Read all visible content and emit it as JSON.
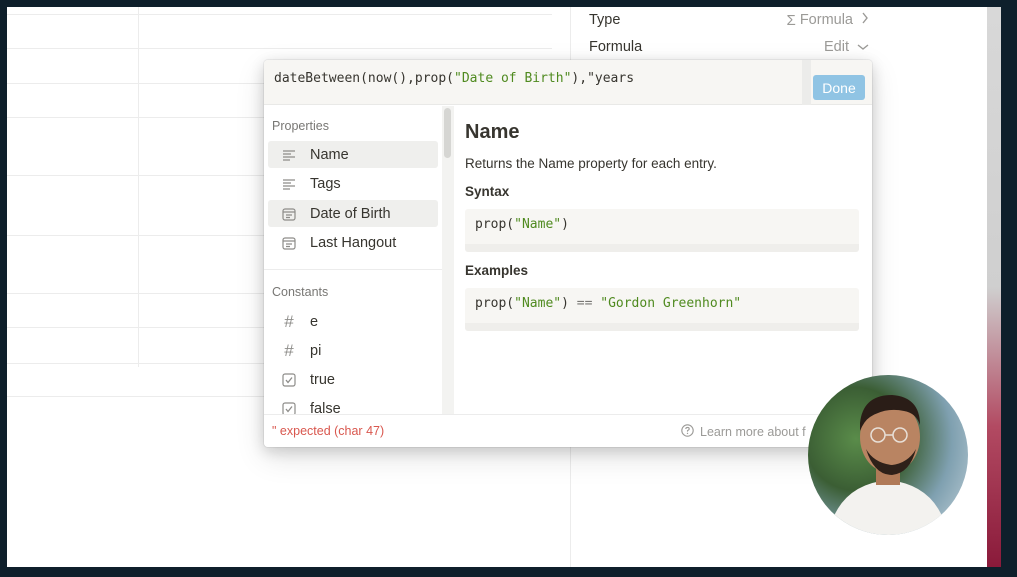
{
  "side_panel": {
    "type_label": "Type",
    "type_value": "Formula",
    "type_icon": "sigma-icon",
    "formula_label": "Formula",
    "formula_value": "Edit"
  },
  "editor": {
    "code_prefix": "dateBetween(now(),prop(",
    "code_string": "\"Date of Birth\"",
    "code_suffix": "),\"years",
    "done_label": "Done"
  },
  "properties": {
    "title": "Properties",
    "items": [
      {
        "label": "Name",
        "icon": "text-lines-icon"
      },
      {
        "label": "Tags",
        "icon": "text-lines-icon"
      },
      {
        "label": "Date of Birth",
        "icon": "calendar-icon"
      },
      {
        "label": "Last Hangout",
        "icon": "calendar-icon"
      }
    ]
  },
  "constants": {
    "title": "Constants",
    "items": [
      {
        "label": "e",
        "icon": "hash-icon"
      },
      {
        "label": "pi",
        "icon": "hash-icon"
      },
      {
        "label": "true",
        "icon": "checkbox-icon"
      },
      {
        "label": "false",
        "icon": "checkbox-icon"
      }
    ]
  },
  "detail": {
    "title": "Name",
    "description": "Returns the Name property for each entry.",
    "syntax_heading": "Syntax",
    "syntax_code_pre": "prop(",
    "syntax_code_str": "\"Name\"",
    "syntax_code_post": ")",
    "examples_heading": "Examples",
    "example_code_pre": "prop(",
    "example_code_str1": "\"Name\"",
    "example_code_mid": ") ",
    "example_code_op": "==",
    "example_code_space": " ",
    "example_code_str2": "\"Gordon Greenhorn\""
  },
  "footer": {
    "error": "\" expected (char 47)",
    "learn_more": "Learn more about f"
  },
  "colors": {
    "accent_button": "#90c4e4",
    "string_green": "#4f8a1f",
    "error_red": "#d9574e"
  }
}
